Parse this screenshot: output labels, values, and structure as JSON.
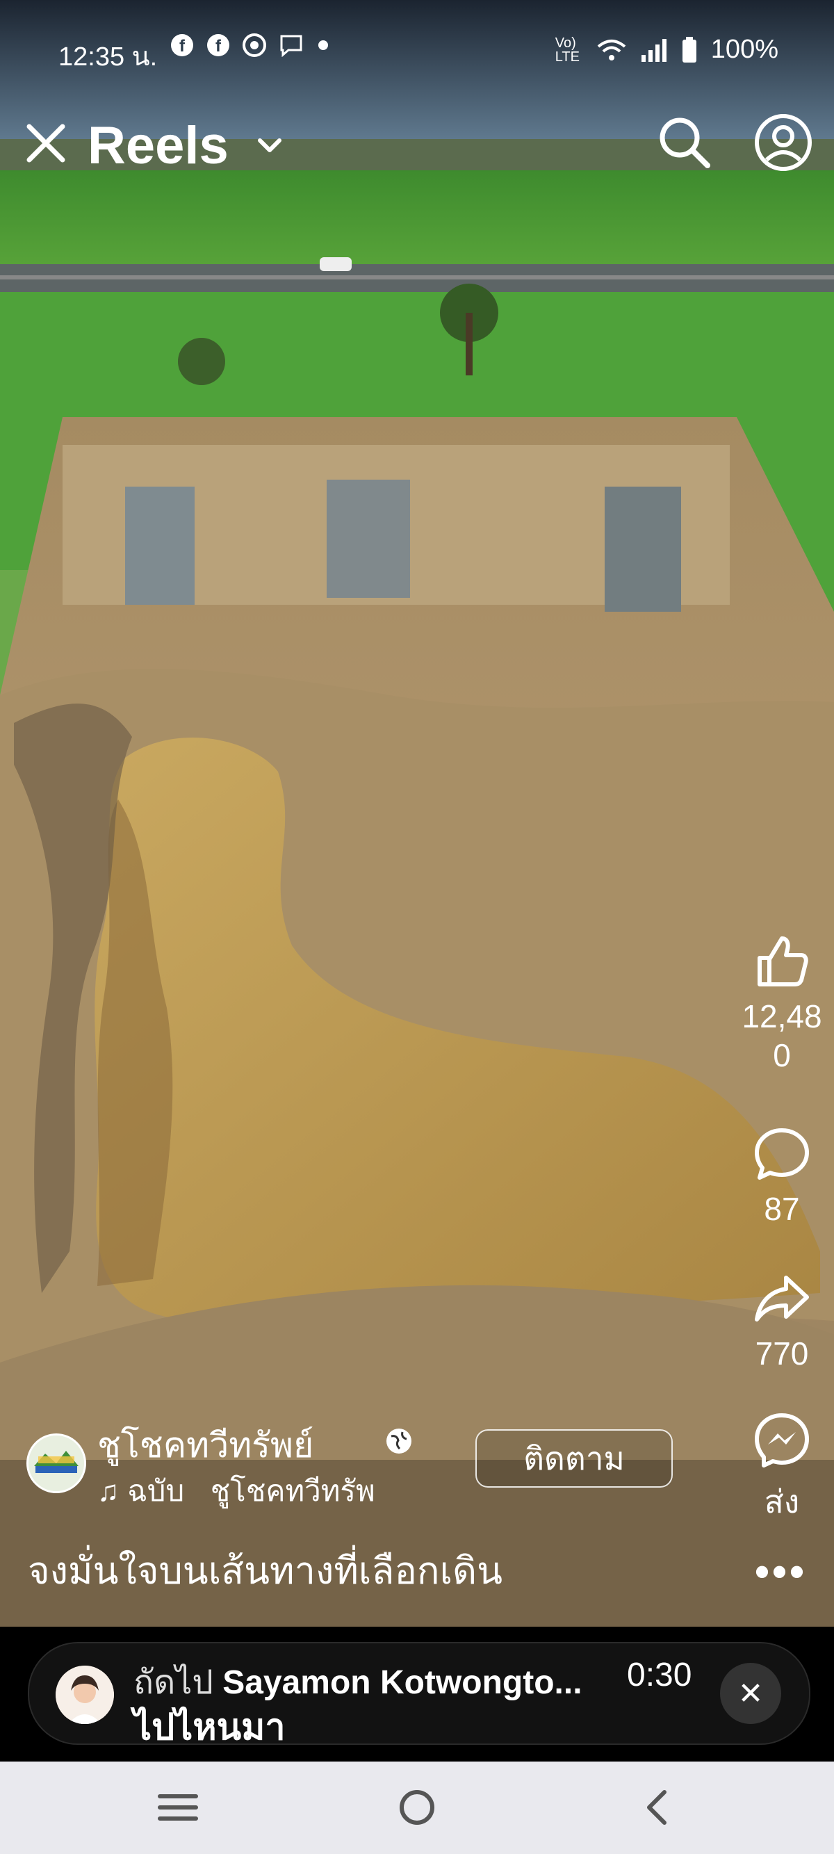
{
  "status": {
    "time": "12:35 น.",
    "network": "Vo) LTE",
    "battery": "100%",
    "notif_icons": [
      "facebook-icon",
      "facebook-icon",
      "chrome-icon",
      "messenger-icon",
      "dot-icon"
    ]
  },
  "topbar": {
    "title": "Reels"
  },
  "actions": {
    "likes": "12,48\n0",
    "comments": "87",
    "shares": "770",
    "send_label": "ส่ง"
  },
  "author": {
    "name": "ชูโชคทวีทรัพย์",
    "audio_prefix": "ฉบับ",
    "audio": "ชูโชคทวีทรัพ",
    "follow": "ติดตาม"
  },
  "caption": "จงมั่นใจบนเส้นทางที่เลือกเดิน",
  "next": {
    "prefix": "ถัดไป",
    "who": "Sayamon Kotwongto...",
    "duration": "0:30",
    "title": "ไปไหนมา"
  },
  "colors": {
    "overlay_dark": "#121212",
    "navbar": "#e9e9ee",
    "grass": "#4f9a2e",
    "soil": "#b59a6b",
    "water": "#b89651"
  }
}
